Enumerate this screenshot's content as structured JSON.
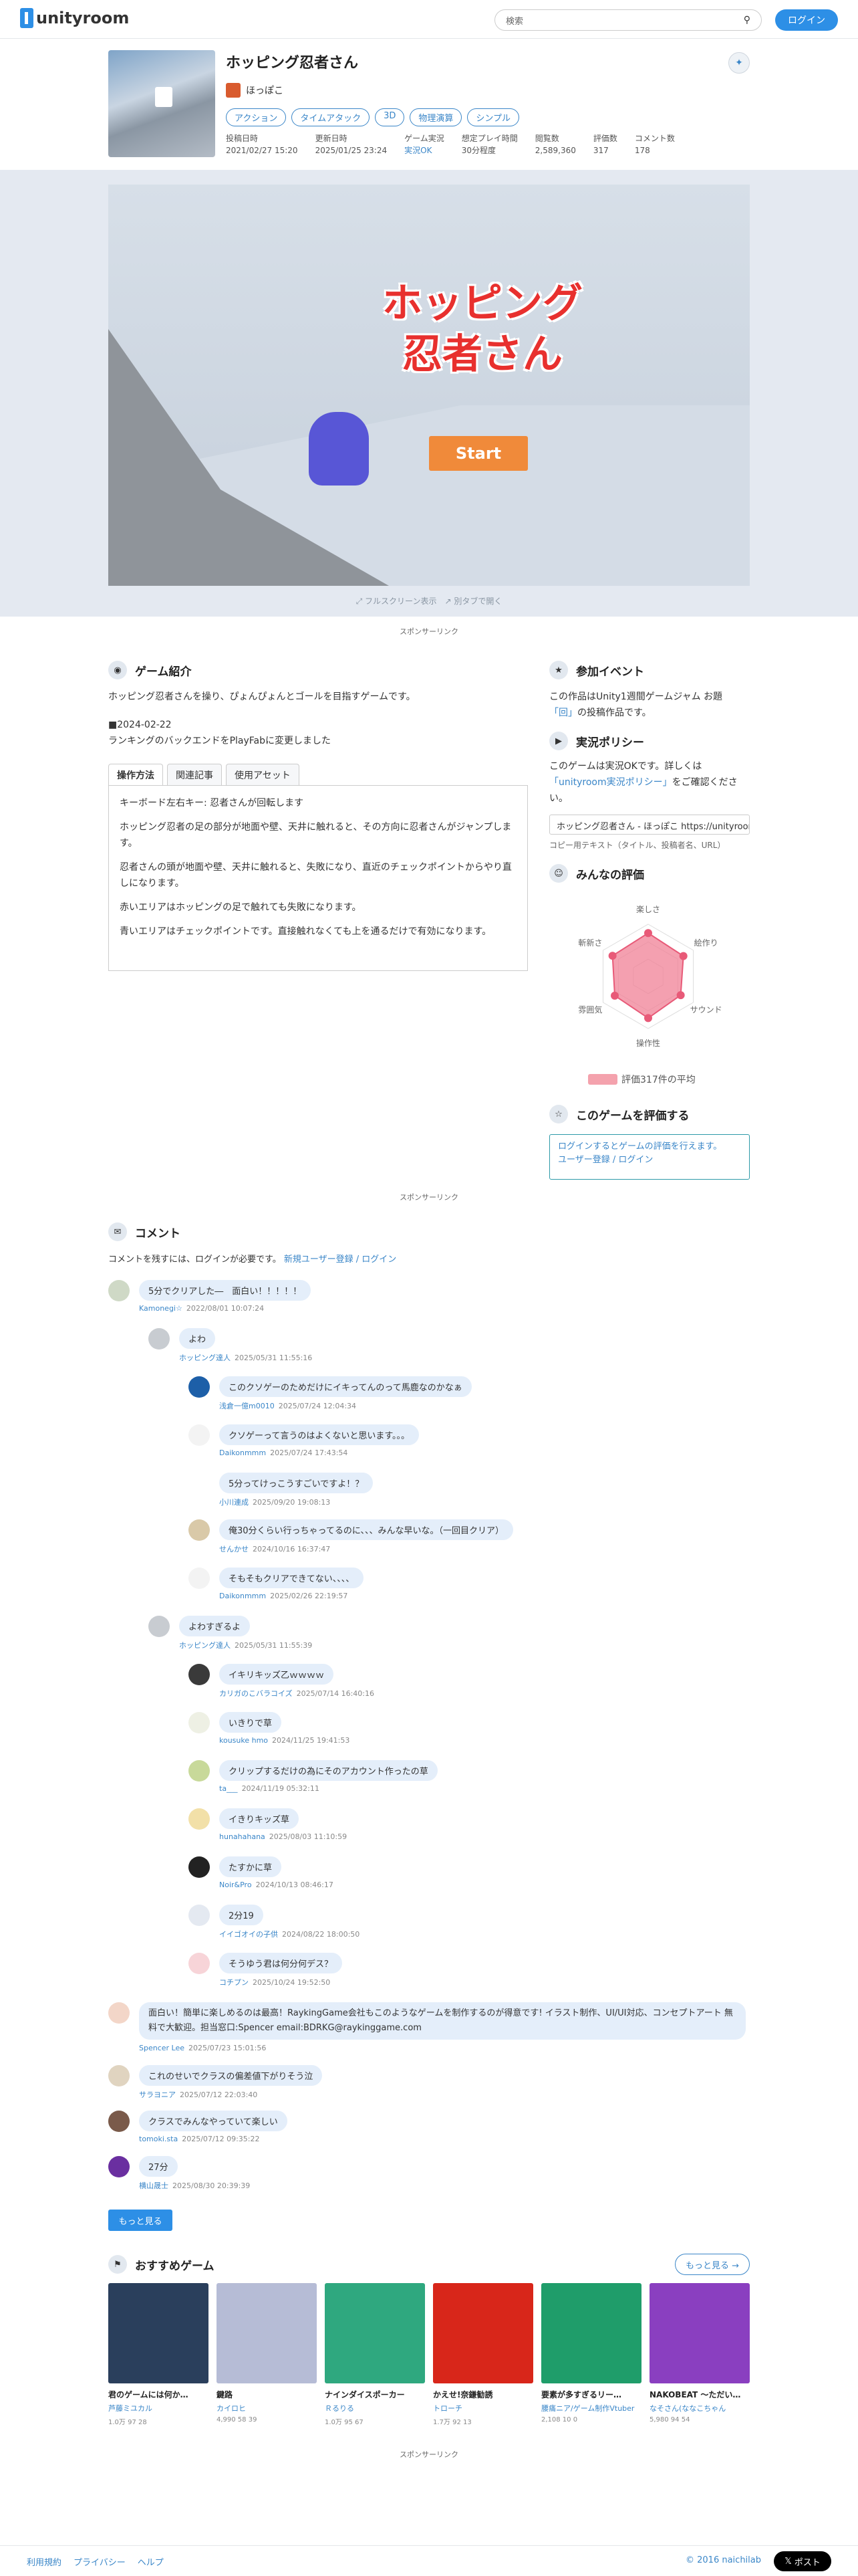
{
  "header": {
    "logo": "unityroom",
    "search_placeholder": "検索",
    "login": "ログイン"
  },
  "game": {
    "title": "ホッピング忍者さん",
    "author": "ほっぽこ",
    "tags": [
      "アクション",
      "タイムアタック",
      "3D",
      "物理演算",
      "シンプル"
    ],
    "stats": [
      {
        "label": "投稿日時",
        "value": "2021/02/27 15:20",
        "icon": "clock-icon"
      },
      {
        "label": "更新日時",
        "value": "2025/01/25 23:24",
        "icon": "refresh-icon"
      },
      {
        "label": "ゲーム実況",
        "value": "実況OK",
        "icon": "video-icon"
      },
      {
        "label": "想定プレイ時間",
        "value": "30分程度",
        "icon": "timer-icon"
      },
      {
        "label": "閲覧数",
        "value": "2,589,360",
        "icon": "eye-icon"
      },
      {
        "label": "評価数",
        "value": "317",
        "icon": "star-icon"
      },
      {
        "label": "コメント数",
        "value": "178",
        "icon": "comment-icon"
      }
    ]
  },
  "player": {
    "title_line1": "ホッピング",
    "title_line2": "忍者さん",
    "start": "Start",
    "fullscreen": "フルスクリーン表示",
    "newtab": "別タブで開く"
  },
  "sponsored": "スポンサーリンク",
  "intro": {
    "heading": "ゲーム紹介",
    "description": "ホッピング忍者さんを操り、ぴょんぴょんとゴールを目指すゲームです。",
    "update_date": "■2024-02-22",
    "update_note": "ランキングのバックエンドをPlayFabに変更しました",
    "tabs": [
      "操作方法",
      "関連記事",
      "使用アセット"
    ],
    "howto": [
      "キーボード左右キー: 忍者さんが回転します",
      "ホッピング忍者の足の部分が地面や壁、天井に触れると、その方向に忍者さんがジャンプします。",
      "忍者さんの頭が地面や壁、天井に触れると、失敗になり、直近のチェックポイントからやり直しになります。",
      "赤いエリアはホッピングの足で触れても失敗になります。",
      "青いエリアはチェックポイントです。直接触れなくても上を通るだけで有効になります。"
    ]
  },
  "side": {
    "event_heading": "参加イベント",
    "event_text1": "この作品はUnity1週間ゲームジャム お題",
    "event_theme": "「回」",
    "event_text2": "の投稿作品です。",
    "policy_heading": "実況ポリシー",
    "policy_text1": "このゲームは実況OKです。詳しくは",
    "policy_link": "「unityroom実況ポリシー」",
    "policy_text2": "をご確認ください。",
    "embed_value": "ホッピング忍者さん - ほっぽこ https://unityroom.com/games/hopping_ninja",
    "embed_caption": "コピー用テキスト（タイトル、投稿者名、URL）",
    "rating_heading": "みんなの評価",
    "radar_labels": [
      "楽しさ",
      "絵作り",
      "サウンド",
      "操作性",
      "雰囲気",
      "斬新さ"
    ],
    "radar_values": [
      0.83,
      0.78,
      0.72,
      0.8,
      0.74,
      0.79
    ],
    "avg_text": "評価317件の平均",
    "rate_heading": "このゲームを評価する",
    "rate_text": "ログインするとゲームの評価を行えます。",
    "rate_links": "ユーザー登録 / ログイン"
  },
  "comments": {
    "heading": "コメント",
    "notice": "コメントを残すには、ログインが必要です。",
    "notice_link": "新規ユーザー登録 / ログイン",
    "items": [
      {
        "text": "5分でクリアした―　面白い！！！！！",
        "name": "Kamonegi☆",
        "date": "2022/08/01 10:07:24"
      },
      {
        "text": "よわ",
        "name": "ホッピング達人",
        "date": "2025/05/31 11:55:16"
      },
      {
        "text": "このクソゲーのためだけにイキってんのって馬鹿なのかなぁ",
        "name": "浅倉一億m0010",
        "date": "2025/07/24 12:04:34"
      },
      {
        "text": "クソゲーって言うのはよくないと思います。。。",
        "name": "Daikonmmm",
        "date": "2025/07/24 17:43:54"
      },
      {
        "text": "5分ってけっこうすごいですよ！？",
        "name": "小川連成",
        "date": "2025/09/20 19:08:13"
      },
      {
        "text": "俺30分くらい行っちゃってるのに、、、みんな早いな。（一回目クリア）",
        "name": "せんかせ",
        "date": "2024/10/16 16:37:47"
      },
      {
        "text": "そもそもクリアできてない、、、、",
        "name": "Daikonmmm",
        "date": "2025/02/26 22:19:57"
      },
      {
        "text": "よわすぎるよ",
        "name": "ホッピング達人",
        "date": "2025/05/31 11:55:39"
      },
      {
        "text": "イキリキッズ乙ｗｗｗｗ",
        "name": "カリガのこバラコイズ",
        "date": "2025/07/14 16:40:16"
      },
      {
        "text": "いきりで草",
        "name": "kousuke hmo",
        "date": "2024/11/25 19:41:53"
      },
      {
        "text": "クリップするだけの為にそのアカウント作ったの草",
        "name": "ta___",
        "date": "2024/11/19 05:32:11"
      },
      {
        "text": "イきりキッズ草",
        "name": "hunahahana",
        "date": "2025/08/03 11:10:59"
      },
      {
        "text": "たすかに草",
        "name": "Noir&Pro",
        "date": "2024/10/13 08:46:17"
      },
      {
        "text": "2分19",
        "name": "イイゴオイの子供",
        "date": "2024/08/22 18:00:50"
      },
      {
        "text": "そうゆう君は何分何デス？",
        "name": "コチプン",
        "date": "2025/10/24 19:52:50"
      },
      {
        "text": "面白い！簡単に楽しめるのは最高！RaykingGame会社もこのようなゲームを制作するのが得意です! イラスト制作、UI/UI対応、コンセプトアート 無料で大歓迎。担当窓口:Spencer email:BDRKG@raykinggame.com",
        "name": "Spencer Lee",
        "date": "2025/07/23 15:01:56"
      },
      {
        "text": "これのせいでクラスの偏差値下がりそう泣",
        "name": "サラヨニア",
        "date": "2025/07/12 22:03:40"
      },
      {
        "text": "クラスでみんなやっていて楽しい",
        "name": "tomoki.sta",
        "date": "2025/07/12 09:35:22"
      },
      {
        "text": "27分",
        "name": "横山晟士",
        "date": "2025/08/30 20:39:39"
      }
    ],
    "more": "もっと見る"
  },
  "recommended": {
    "heading": "おすすめゲーム",
    "more": "もっと見る →",
    "games": [
      {
        "title": "君のゲームには何か…",
        "author": "芦藤ミユカル",
        "stats": "1.0万 97 28",
        "color": "#2a3f5c"
      },
      {
        "title": "鍵路",
        "author": "カイロヒ",
        "stats": "4,990 58 39",
        "color": "#b6bcd6"
      },
      {
        "title": "ナインダイスポーカー",
        "author": "Ｒるりる",
        "stats": "1.0万 95 67",
        "color": "#2fa87f"
      },
      {
        "title": "かえせ!奈鎌勧誘",
        "author": "トローチ",
        "stats": "1.7万 92 13",
        "color": "#d8261a"
      },
      {
        "title": "要素が多すぎるリー…",
        "author": "腰痛ニア/ゲーム制作Vtuber",
        "stats": "2,108 10 0",
        "color": "#1f9d6a"
      },
      {
        "title": "NAKOBEAT ～ただい…",
        "author": "なそさん(ななこちゃん",
        "stats": "5,980 94 54",
        "color": "#8a3fc0"
      }
    ]
  },
  "footer": {
    "links": [
      "利用規約",
      "プライバシー",
      "ヘルプ"
    ],
    "copyright": "© 2016 naichilab",
    "post": "ポスト"
  }
}
